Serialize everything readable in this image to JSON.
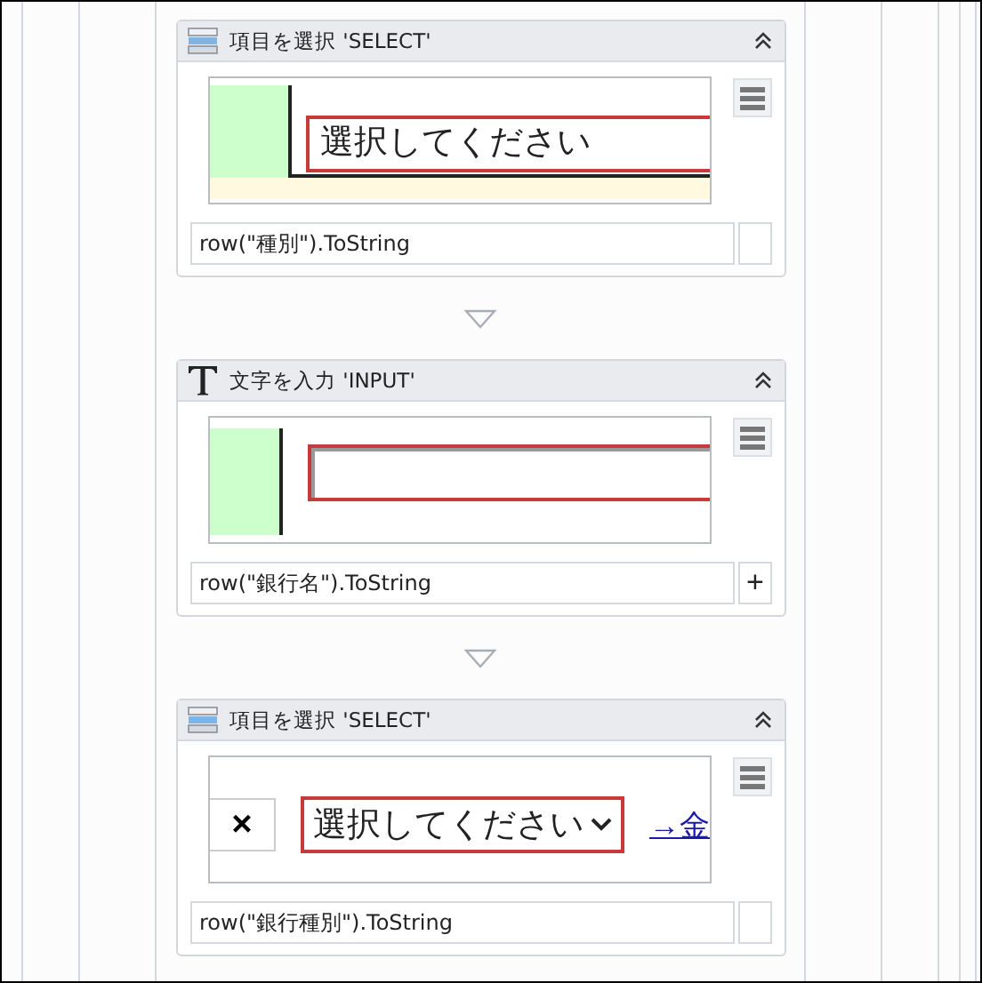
{
  "activities": [
    {
      "kind": "select",
      "title": "項目を選択 'SELECT'",
      "expanded": true,
      "preview": {
        "kind": "select-row",
        "select_text": "選択してください"
      },
      "expression": "row(\"種別\").ToString"
    },
    {
      "kind": "type",
      "title": "文字を入力 'INPUT'",
      "expanded": true,
      "preview": {
        "kind": "input-row"
      },
      "expression": "row(\"銀行名\").ToString",
      "expression_button": "+"
    },
    {
      "kind": "select",
      "title": "項目を選択 'SELECT'",
      "expanded": true,
      "preview": {
        "kind": "select-clear",
        "clear_text": "×",
        "select_text": "選択してください",
        "link_text": "→金"
      },
      "expression": "row(\"銀行種別\").ToString"
    }
  ]
}
